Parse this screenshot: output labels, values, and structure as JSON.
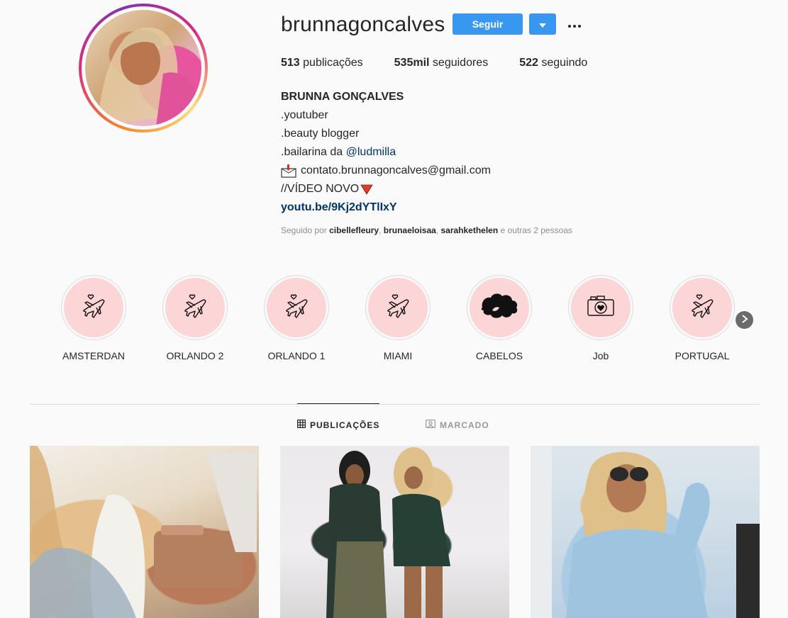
{
  "profile": {
    "username": "brunnagoncalves",
    "follow_label": "Seguir",
    "more_label": "...",
    "stats": {
      "posts_count": "513",
      "posts_label": "publicações",
      "followers_count": "535mil",
      "followers_label": "seguidores",
      "following_count": "522",
      "following_label": "seguindo"
    },
    "bio": {
      "name": "BRUNNA GONÇALVES",
      "line1": ".youtuber",
      "line2": ".beauty blogger",
      "line3_prefix": ".bailarina da ",
      "line3_mention": "@ludmilla",
      "email": "contato.brunnagoncalves@gmail.com",
      "video_line": "//VÍDEO NOVO",
      "link": "youtu.be/9Kj2dYTlIxY"
    },
    "followed_by": {
      "prefix": "Seguido por ",
      "users": [
        "cibellefleury",
        "brunaeloisaa",
        "sarahkethelen"
      ],
      "suffix": " e outras 2 pessoas"
    }
  },
  "highlights": [
    {
      "label": "AMSTERDAN",
      "icon": "airplane-heart-icon"
    },
    {
      "label": "ORLANDO 2",
      "icon": "airplane-heart-icon"
    },
    {
      "label": "ORLANDO 1",
      "icon": "airplane-heart-icon"
    },
    {
      "label": "MIAMI",
      "icon": "airplane-heart-icon"
    },
    {
      "label": "CABELOS",
      "icon": "hair-icon"
    },
    {
      "label": "Job",
      "icon": "camera-heart-icon"
    },
    {
      "label": "PORTUGAL",
      "icon": "airplane-heart-icon"
    }
  ],
  "tabs": {
    "posts": "PUBLICAÇÕES",
    "tagged": "MARCADO"
  },
  "colors": {
    "accent": "#3897f0",
    "highlight_bg": "#fcd5d7",
    "link": "#003569",
    "muted": "#8e8e8e"
  }
}
